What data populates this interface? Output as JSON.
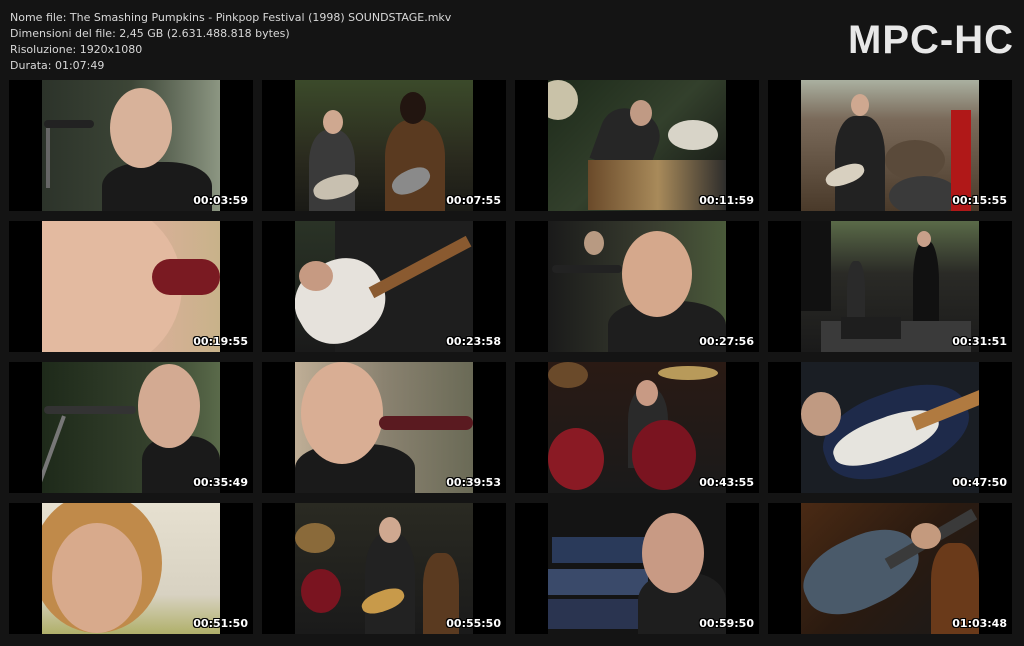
{
  "header": {
    "file_name": "Nome file: The Smashing Pumpkins - Pinkpop Festival (1998) SOUNDSTAGE.mkv",
    "file_size": "Dimensioni del file: 2,45 GB (2.631.488.818 bytes)",
    "resolution": "Risoluzione: 1920x1080",
    "duration": "Durata: 01:07:49"
  },
  "logo": "MPC-HC",
  "thumbnails": [
    {
      "time": "00:03:59",
      "scene": "singer-closeup-mic"
    },
    {
      "time": "00:07:55",
      "scene": "band-guitarists"
    },
    {
      "time": "00:11:59",
      "scene": "drummer-overhead"
    },
    {
      "time": "00:15:55",
      "scene": "stage-crowd"
    },
    {
      "time": "00:19:55",
      "scene": "singer-extreme-closeup"
    },
    {
      "time": "00:23:58",
      "scene": "guitar-closeup"
    },
    {
      "time": "00:27:56",
      "scene": "singer-shouting"
    },
    {
      "time": "00:31:51",
      "scene": "stage-wide"
    },
    {
      "time": "00:35:49",
      "scene": "singer-profile-mic"
    },
    {
      "time": "00:39:53",
      "scene": "singer-singing"
    },
    {
      "time": "00:43:55",
      "scene": "drummer-kit"
    },
    {
      "time": "00:47:50",
      "scene": "bass-closeup"
    },
    {
      "time": "00:51:50",
      "scene": "bassist-profile"
    },
    {
      "time": "00:55:50",
      "scene": "guitarist-with-drums"
    },
    {
      "time": "00:59:50",
      "scene": "keyboardist"
    },
    {
      "time": "01:03:48",
      "scene": "guitar-hands"
    }
  ]
}
